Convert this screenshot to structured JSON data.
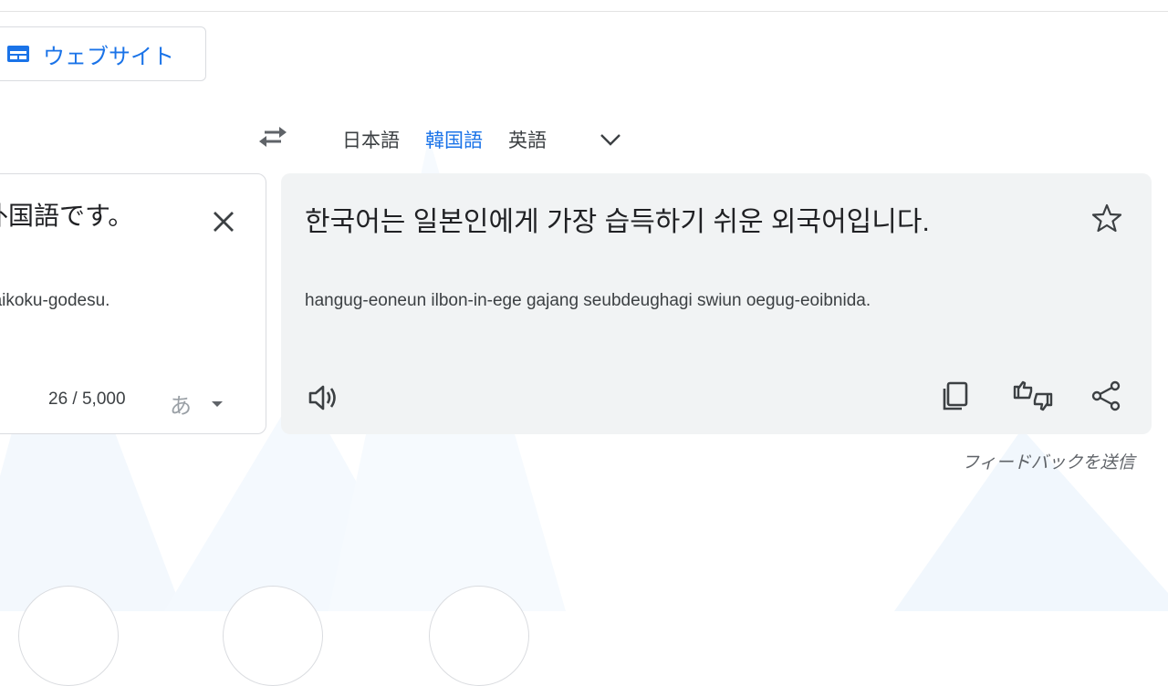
{
  "header": {
    "website_button_label": "ウェブサイト"
  },
  "languages": {
    "tabs": [
      "日本語",
      "韓国語",
      "英語"
    ],
    "active_index": 1
  },
  "source": {
    "text": "外国語です。",
    "romanization": "gaikoku-godesu.",
    "char_count": "26 / 5,000",
    "ime_label": "あ"
  },
  "target": {
    "text": "한국어는 일본인에게 가장 습득하기 쉬운 외국어입니다.",
    "romanization": "hangug-eoneun ilbon-in-ege gajang seubdeughagi swiun oegug-eoibnida."
  },
  "footer": {
    "feedback_label": "フィードバックを送信"
  },
  "colors": {
    "accent": "#1a73e8",
    "panel_bg": "#f1f3f4",
    "border": "#dadce0",
    "icon": "#5f6368"
  },
  "icons": {
    "website": "web-page-icon",
    "swap": "swap-languages-icon",
    "more_languages": "chevron-down-icon",
    "clear": "close-icon",
    "star": "star-icon",
    "listen": "speaker-icon",
    "copy": "copy-icon",
    "rate": "thumbs-rating-icon",
    "share": "share-icon"
  }
}
